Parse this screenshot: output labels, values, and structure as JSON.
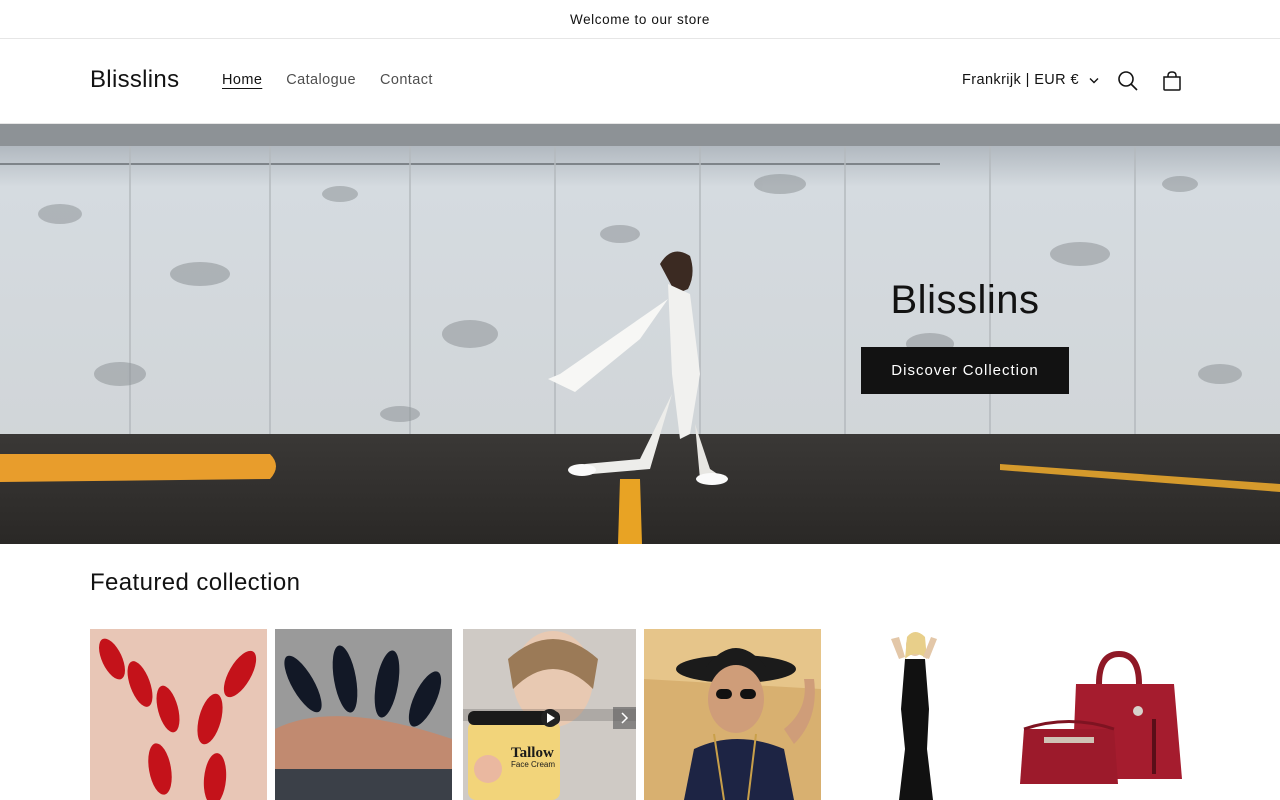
{
  "announcement": {
    "text": "Welcome to our store"
  },
  "header": {
    "logo": "Blisslins",
    "nav": [
      {
        "label": "Home",
        "active": true
      },
      {
        "label": "Catalogue",
        "active": false
      },
      {
        "label": "Contact",
        "active": false
      }
    ],
    "localization": "Frankrijk | EUR €",
    "icons": [
      "search-icon",
      "cart-icon",
      "chevron-down-icon"
    ]
  },
  "hero": {
    "title": "Blisslins",
    "button_label": "Discover Collection"
  },
  "featured": {
    "title": "Featured collection",
    "products": [
      {
        "name": "red-nails"
      },
      {
        "name": "black-nails"
      },
      {
        "name": "tallow-face-cream",
        "image_text": "Tallow",
        "image_subtext": "Face Cream"
      },
      {
        "name": "hat-model"
      },
      {
        "name": "black-dress"
      },
      {
        "name": "red-handbags"
      }
    ]
  },
  "colors": {
    "text": "#121212",
    "button_bg": "#121212",
    "button_text": "#ffffff",
    "border": "#e6e6e6"
  }
}
